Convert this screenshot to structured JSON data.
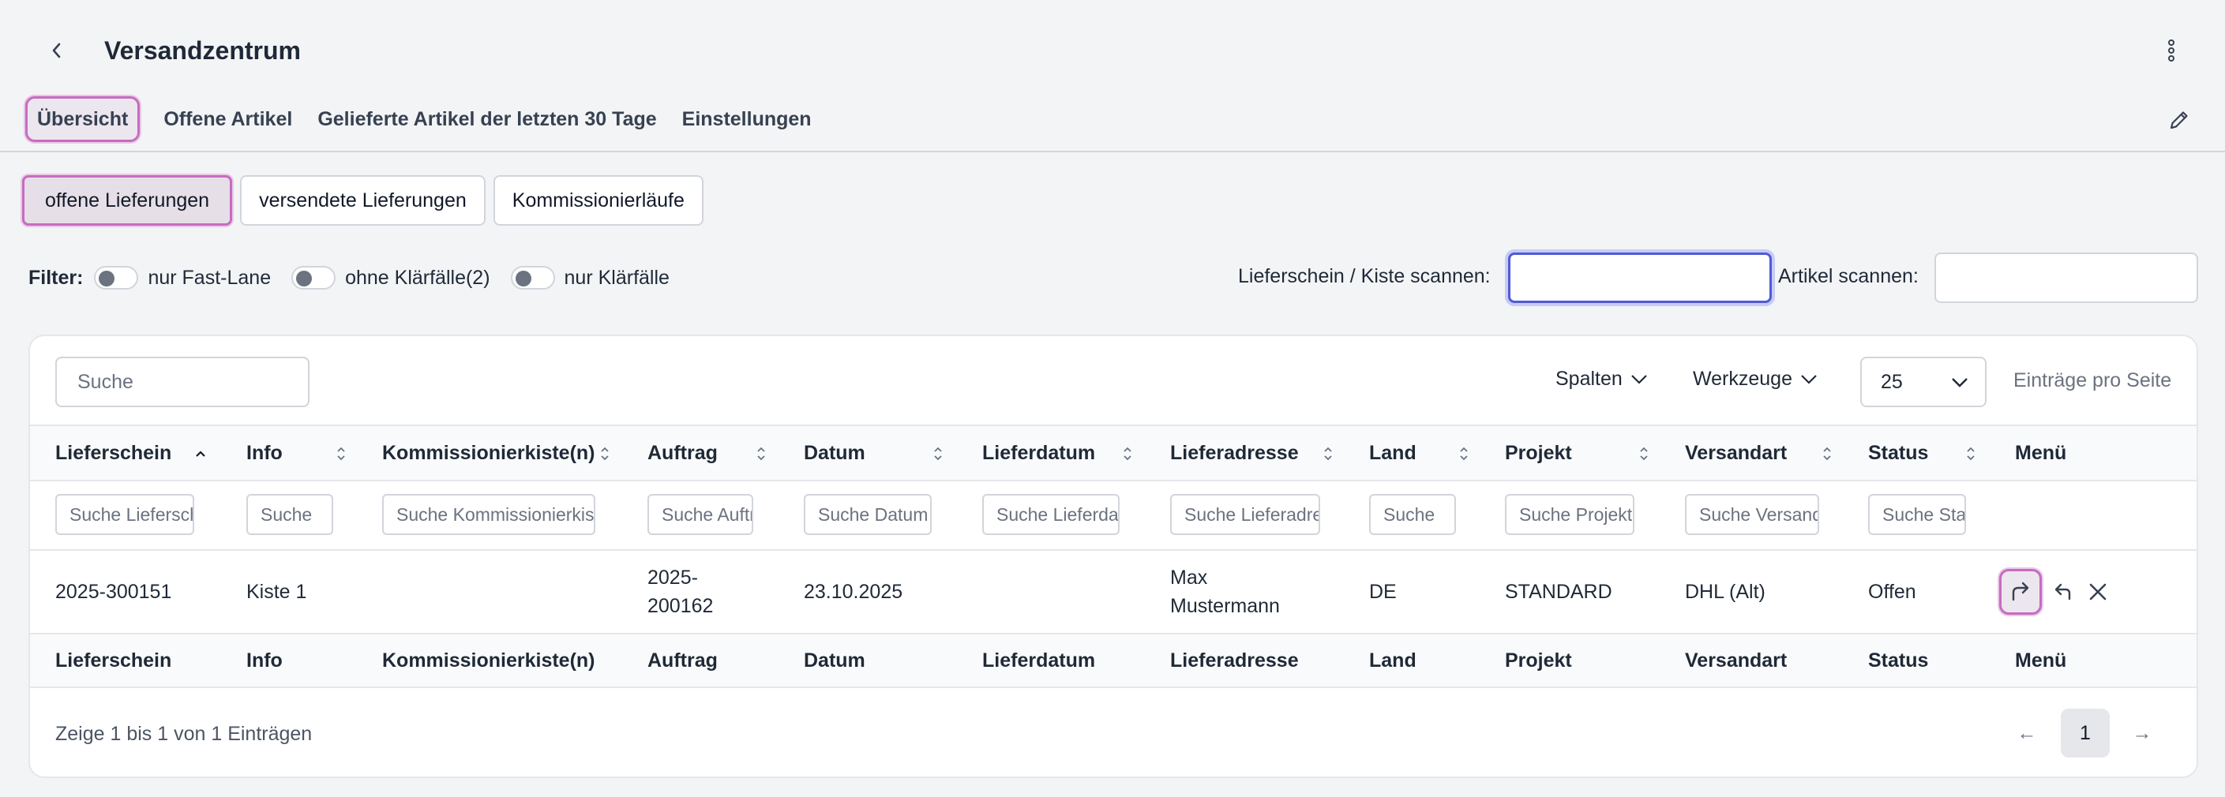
{
  "header": {
    "title": "Versandzentrum"
  },
  "tabs": [
    {
      "label": "Übersicht",
      "active": true
    },
    {
      "label": "Offene Artikel"
    },
    {
      "label": "Gelieferte Artikel der letzten 30 Tage"
    },
    {
      "label": "Einstellungen"
    }
  ],
  "subtabs": [
    {
      "label": "offene Lieferungen",
      "active": true
    },
    {
      "label": "versendete Lieferungen"
    },
    {
      "label": "Kommissionierläufe"
    }
  ],
  "filters": {
    "label": "Filter",
    "toggles": [
      {
        "label": "nur Fast-Lane",
        "on": false
      },
      {
        "label": "ohne Klärfälle(2)",
        "on": false
      },
      {
        "label": "nur Klärfälle",
        "on": false
      }
    ],
    "scan_delivery_label": "Lieferschein / Kiste scannen:",
    "scan_article_label": "Artikel scannen:"
  },
  "table_tools": {
    "search_placeholder": "Suche",
    "columns_label": "Spalten",
    "tools_label": "Werkzeuge",
    "page_size": "25",
    "per_page_label": "Einträge pro Seite"
  },
  "table": {
    "columns": [
      "Lieferschein",
      "Info",
      "Kommissionierkiste(n)",
      "Auftrag",
      "Datum",
      "Lieferdatum",
      "Lieferadresse",
      "Land",
      "Projekt",
      "Versandart",
      "Status",
      "Menü"
    ],
    "filter_placeholders": [
      "Suche Lieferschein",
      "Suche",
      "Suche Kommissionierkiste",
      "Suche Auftrag",
      "Suche Datum",
      "Suche Lieferdatum",
      "Suche Lieferadresse",
      "Suche",
      "Suche Projekt",
      "Suche Versandart",
      "Suche Status"
    ],
    "rows": [
      {
        "lieferschein": "2025-300151",
        "info": "Kiste 1",
        "kiste": "",
        "auftrag_line1": "2025-",
        "auftrag_line2": "200162",
        "datum": "23.10.2025",
        "lieferdatum": "",
        "adresse_line1": "Max",
        "adresse_line2": "Mustermann",
        "land": "DE",
        "projekt": "STANDARD",
        "versandart": "DHL (Alt)",
        "status": "Offen"
      }
    ]
  },
  "pagination": {
    "info": "Zeige 1 bis 1 von 1 Einträgen",
    "current_page": "1",
    "prev_symbol": "←",
    "next_symbol": "→"
  },
  "colors": {
    "accent_highlight": "#c66cc0",
    "focus_ring": "#4f5bd5"
  }
}
